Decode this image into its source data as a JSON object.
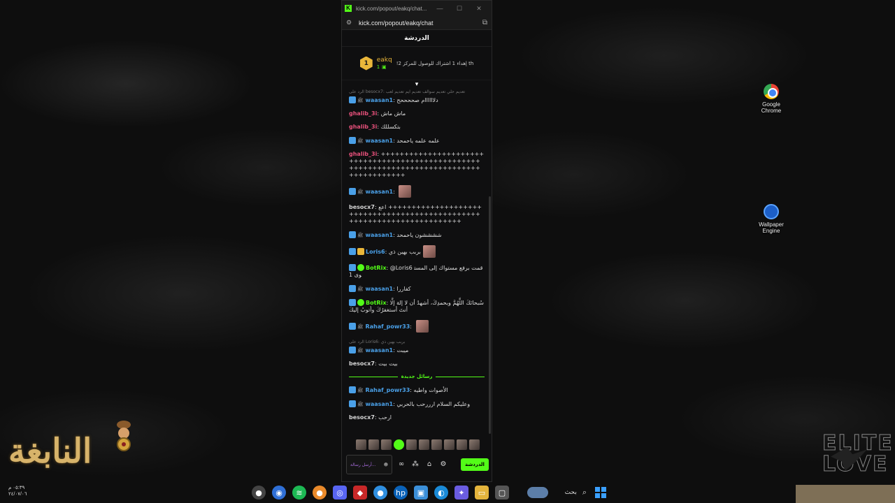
{
  "desktop": {
    "icons": [
      {
        "label_line1": "Google",
        "label_line2": "Chrome",
        "icon": "chrome-icon"
      },
      {
        "label_line1": "Wallpaper",
        "label_line2": "Engine",
        "icon": "wallpaper-engine-icon"
      }
    ],
    "clock": {
      "time": "٠٥:٣٩ م",
      "date": "٢٤/٠٧/٠٦"
    }
  },
  "browser": {
    "tab_title": "kick.com/popout/eakq/chat...",
    "url": "kick.com/popout/eakq/chat"
  },
  "chat": {
    "header": "الدردشة",
    "pinned": {
      "username": "eakq",
      "badge_number": "1",
      "count": "1",
      "text": "!إهداء 1 اشتراك للوصول للمركز 2 th"
    },
    "messages": [
      {
        "type": "reply",
        "text": "الرد على besocx7: تعديم حلي تعديم سوالف تعديم ايم تعديم لعب"
      },
      {
        "user": "waasan1",
        "color": "#4aa0e8",
        "badges": [
          "og",
          "ico"
        ],
        "text": "دلاااااام صححححح"
      },
      {
        "user": "ghalib_3i",
        "color": "#e5507a",
        "badges": [],
        "text": "ماش ماش"
      },
      {
        "user": "ghalib_3i",
        "color": "#e5507a",
        "badges": [],
        "text": "بتكسللك"
      },
      {
        "user": "waasan1",
        "color": "#4aa0e8",
        "badges": [
          "og",
          "ico"
        ],
        "text": "علمه علمه ياحمحد"
      },
      {
        "user": "ghalib_3i",
        "color": "#e5507a",
        "badges": [],
        "text": "++++++++++++++++++++++++++++++++++++++++++++++++++++++++++++++++++++++++++++++++++++++++++"
      },
      {
        "user": "waasan1",
        "color": "#4aa0e8",
        "badges": [
          "og",
          "ico"
        ],
        "text": "",
        "emote": true
      },
      {
        "user": "besocx7",
        "color": "#d4d4d4",
        "badges": [],
        "text": "اعع ++++++++++++++++++++++++++++++++++++++++++++++++++++++++++++++++++++++++"
      },
      {
        "user": "waasan1",
        "color": "#4aa0e8",
        "badges": [
          "og",
          "ico"
        ],
        "text": "ششششون ياحمحد"
      },
      {
        "user": "Loris6",
        "color": "#4aa0e8",
        "badges": [
          "og",
          "crown"
        ],
        "text": "بربب بهين ذي",
        "emote": true
      },
      {
        "user": "BotRix",
        "color": "#53fc18",
        "badges": [
          "og",
          "bot"
        ],
        "text": "@Loris6 قمت برفع مستواك إلى المستوى 1"
      },
      {
        "user": "waasan1",
        "color": "#4aa0e8",
        "badges": [
          "og",
          "ico"
        ],
        "text": "كفاررا"
      },
      {
        "user": "BotRix",
        "color": "#53fc18",
        "badges": [
          "og",
          "bot"
        ],
        "text": "سُبحانَكَ اللَّهُمَّ وبحمدِكَ، أشهدُ أن لا إلهَ إلَّا أنتَ أستغفرُكَ وأتوبُ إليكَ"
      },
      {
        "user": "Rahaf_powr33",
        "color": "#4aa0e8",
        "badges": [
          "og",
          "ico"
        ],
        "text": "",
        "emote": true
      },
      {
        "type": "reply",
        "text": "الرد على Loris6: بربب بهين ذي"
      },
      {
        "user": "waasan1",
        "color": "#4aa0e8",
        "badges": [
          "og",
          "ico"
        ],
        "text": "ميبت"
      },
      {
        "user": "besocx7",
        "color": "#d4d4d4",
        "badges": [],
        "text": "بيت بيت"
      }
    ],
    "new_messages_divider": "رسائل جديدة",
    "new_messages": [
      {
        "user": "Rahaf_powr33",
        "color": "#4aa0e8",
        "badges": [
          "og",
          "ico"
        ],
        "text": "الأصوات واطيه"
      },
      {
        "user": "waasan1",
        "color": "#4aa0e8",
        "badges": [
          "og",
          "ico"
        ],
        "text": "وعليكم السلام ارررحب بالحربي"
      },
      {
        "user": "besocx7",
        "color": "#d4d4d4",
        "badges": [],
        "text": "ارحب"
      }
    ],
    "input_placeholder": "أرسل رسالة...",
    "send_button": "الدردشة"
  },
  "taskbar": {
    "search_label": "بحث"
  },
  "colors": {
    "kick_green": "#53fc18",
    "gold": "#e9b63a",
    "og_blue": "#4aa0e8",
    "pink_user": "#e5507a"
  }
}
